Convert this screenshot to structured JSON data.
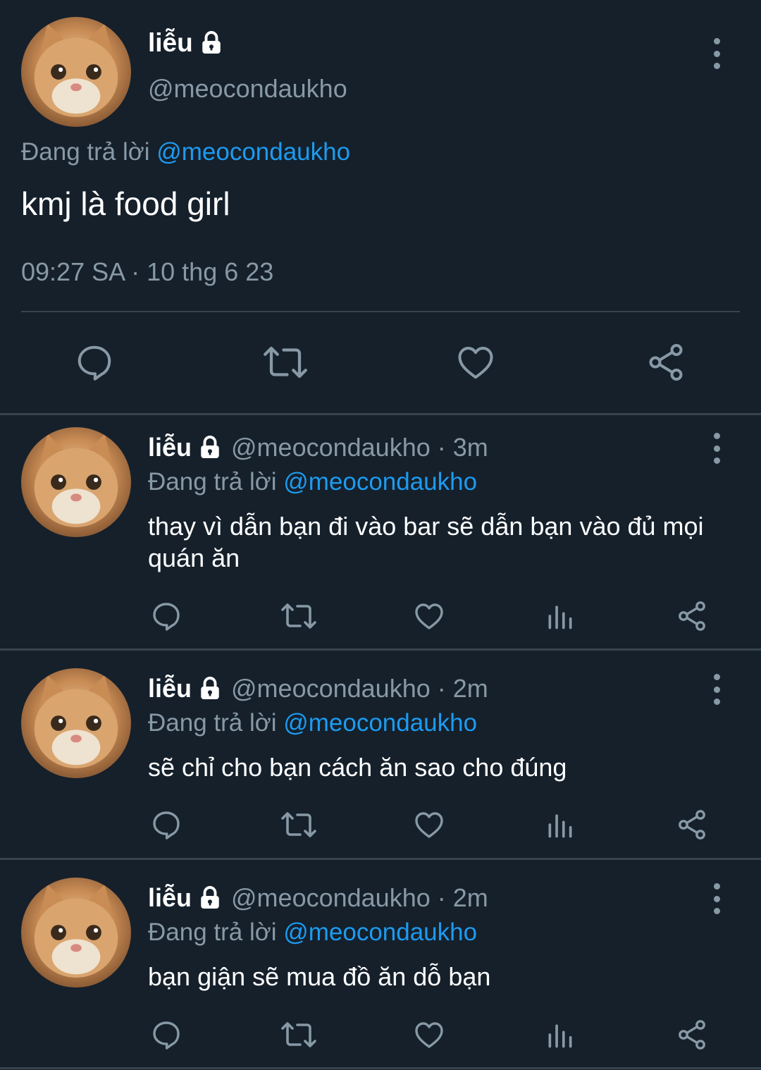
{
  "main_tweet": {
    "name": "liễu",
    "handle": "@meocondaukho",
    "replying_prefix": "Đang trả lời",
    "replying_to": "@meocondaukho",
    "text": "kmj là food girl",
    "timestamp": "09:27 SA · 10 thg 6 23",
    "actions": [
      "reply-icon",
      "retweet-icon",
      "like-icon",
      "share-icon"
    ]
  },
  "replies": [
    {
      "name": "liễu",
      "handle": "@meocondaukho",
      "time": "· 3m",
      "replying_prefix": "Đang trả lời",
      "replying_to": "@meocondaukho",
      "text": "thay vì dẫn bạn đi vào bar sẽ dẫn bạn vào đủ mọi quán ăn"
    },
    {
      "name": "liễu",
      "handle": "@meocondaukho",
      "time": "· 2m",
      "replying_prefix": "Đang trả lời",
      "replying_to": "@meocondaukho",
      "text": "sẽ chỉ cho bạn cách ăn sao cho đúng"
    },
    {
      "name": "liễu",
      "handle": "@meocondaukho",
      "time": "· 2m",
      "replying_prefix": "Đang trả lời",
      "replying_to": "@meocondaukho",
      "text": "bạn giận sẽ mua đồ ăn dỗ bạn"
    }
  ],
  "colors": {
    "background": "#15202b",
    "muted": "#8899a6",
    "mention": "#1d9bf0",
    "divider": "#38444d"
  }
}
